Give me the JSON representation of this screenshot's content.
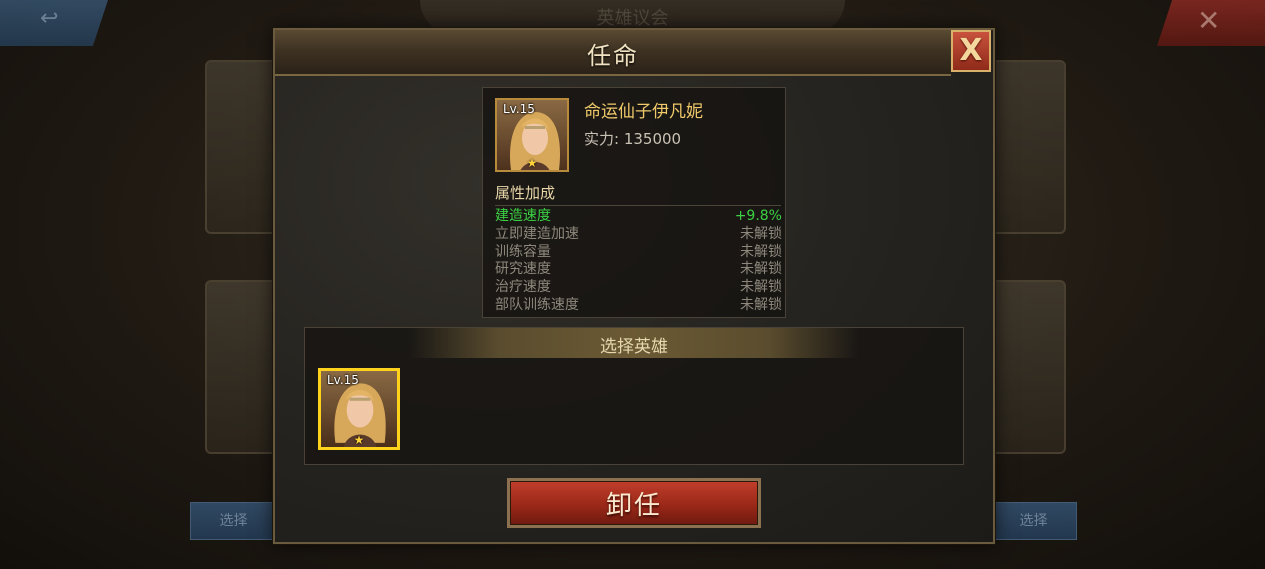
{
  "background": {
    "header_title": "英雄议会",
    "back_label": "↩",
    "close_label": "✕",
    "left_button_label": "选择",
    "right_button_label": "选择"
  },
  "dialog": {
    "title": "任命",
    "close_label": "X"
  },
  "hero": {
    "level": "Lv.15",
    "name": "命运仙子伊凡妮",
    "power_label": "实力:",
    "power_value": "135000",
    "stars": 1
  },
  "attributes": {
    "title": "属性加成",
    "rows": [
      {
        "name": "建造速度",
        "value": "+9.8%",
        "active": true
      },
      {
        "name": "立即建造加速",
        "value": "未解锁",
        "active": false
      },
      {
        "name": "训练容量",
        "value": "未解锁",
        "active": false
      },
      {
        "name": "研究速度",
        "value": "未解锁",
        "active": false
      },
      {
        "name": "治疗速度",
        "value": "未解锁",
        "active": false
      },
      {
        "name": "部队训练速度",
        "value": "未解锁",
        "active": false
      }
    ]
  },
  "select": {
    "title": "选择英雄",
    "heroes": [
      {
        "level": "Lv.15",
        "stars": 1,
        "selected": true
      }
    ]
  },
  "dismiss_button": "卸任",
  "colors": {
    "active_attribute": "#3bd143",
    "hero_name": "#f0c96a",
    "selected_border": "#ffd21c",
    "dismiss_button": "#9a2818"
  }
}
